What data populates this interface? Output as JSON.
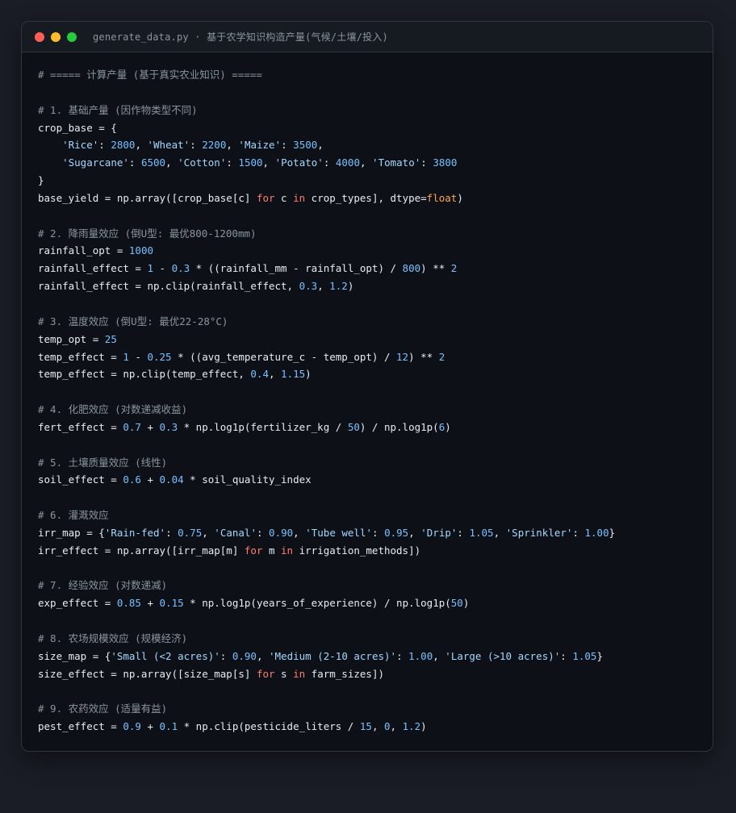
{
  "window": {
    "title": "generate_data.py · 基于农学知识构造产量(气候/土壤/投入)"
  },
  "code_lines": [
    [
      {
        "t": "# ===== 计算产量 (基于真实农业知识) =====",
        "c": "c"
      }
    ],
    [],
    [
      {
        "t": "# 1. 基础产量 (因作物类型不同)",
        "c": "c"
      }
    ],
    [
      {
        "t": "crop_base = {",
        "c": ""
      }
    ],
    [
      {
        "t": "    ",
        "c": ""
      },
      {
        "t": "'Rice'",
        "c": "s"
      },
      {
        "t": ": ",
        "c": ""
      },
      {
        "t": "2800",
        "c": "n"
      },
      {
        "t": ", ",
        "c": ""
      },
      {
        "t": "'Wheat'",
        "c": "s"
      },
      {
        "t": ": ",
        "c": ""
      },
      {
        "t": "2200",
        "c": "n"
      },
      {
        "t": ", ",
        "c": ""
      },
      {
        "t": "'Maize'",
        "c": "s"
      },
      {
        "t": ": ",
        "c": ""
      },
      {
        "t": "3500",
        "c": "n"
      },
      {
        "t": ",",
        "c": ""
      }
    ],
    [
      {
        "t": "    ",
        "c": ""
      },
      {
        "t": "'Sugarcane'",
        "c": "s"
      },
      {
        "t": ": ",
        "c": ""
      },
      {
        "t": "6500",
        "c": "n"
      },
      {
        "t": ", ",
        "c": ""
      },
      {
        "t": "'Cotton'",
        "c": "s"
      },
      {
        "t": ": ",
        "c": ""
      },
      {
        "t": "1500",
        "c": "n"
      },
      {
        "t": ", ",
        "c": ""
      },
      {
        "t": "'Potato'",
        "c": "s"
      },
      {
        "t": ": ",
        "c": ""
      },
      {
        "t": "4000",
        "c": "n"
      },
      {
        "t": ", ",
        "c": ""
      },
      {
        "t": "'Tomato'",
        "c": "s"
      },
      {
        "t": ": ",
        "c": ""
      },
      {
        "t": "3800",
        "c": "n"
      }
    ],
    [
      {
        "t": "}",
        "c": ""
      }
    ],
    [
      {
        "t": "base_yield = np.array([crop_base[c] ",
        "c": ""
      },
      {
        "t": "for",
        "c": "k"
      },
      {
        "t": " c ",
        "c": ""
      },
      {
        "t": "in",
        "c": "k"
      },
      {
        "t": " crop_types], dtype=",
        "c": ""
      },
      {
        "t": "float",
        "c": "b"
      },
      {
        "t": ")",
        "c": ""
      }
    ],
    [],
    [
      {
        "t": "# 2. 降雨量效应 (倒U型: 最优800-1200mm)",
        "c": "c"
      }
    ],
    [
      {
        "t": "rainfall_opt = ",
        "c": ""
      },
      {
        "t": "1000",
        "c": "n"
      }
    ],
    [
      {
        "t": "rainfall_effect = ",
        "c": ""
      },
      {
        "t": "1",
        "c": "n"
      },
      {
        "t": " - ",
        "c": ""
      },
      {
        "t": "0.3",
        "c": "n"
      },
      {
        "t": " * ((rainfall_mm - rainfall_opt) / ",
        "c": ""
      },
      {
        "t": "800",
        "c": "n"
      },
      {
        "t": ") ** ",
        "c": ""
      },
      {
        "t": "2",
        "c": "n"
      }
    ],
    [
      {
        "t": "rainfall_effect = np.clip(rainfall_effect, ",
        "c": ""
      },
      {
        "t": "0.3",
        "c": "n"
      },
      {
        "t": ", ",
        "c": ""
      },
      {
        "t": "1.2",
        "c": "n"
      },
      {
        "t": ")",
        "c": ""
      }
    ],
    [],
    [
      {
        "t": "# 3. 温度效应 (倒U型: 最优22-28°C)",
        "c": "c"
      }
    ],
    [
      {
        "t": "temp_opt = ",
        "c": ""
      },
      {
        "t": "25",
        "c": "n"
      }
    ],
    [
      {
        "t": "temp_effect = ",
        "c": ""
      },
      {
        "t": "1",
        "c": "n"
      },
      {
        "t": " - ",
        "c": ""
      },
      {
        "t": "0.25",
        "c": "n"
      },
      {
        "t": " * ((avg_temperature_c - temp_opt) / ",
        "c": ""
      },
      {
        "t": "12",
        "c": "n"
      },
      {
        "t": ") ** ",
        "c": ""
      },
      {
        "t": "2",
        "c": "n"
      }
    ],
    [
      {
        "t": "temp_effect = np.clip(temp_effect, ",
        "c": ""
      },
      {
        "t": "0.4",
        "c": "n"
      },
      {
        "t": ", ",
        "c": ""
      },
      {
        "t": "1.15",
        "c": "n"
      },
      {
        "t": ")",
        "c": ""
      }
    ],
    [],
    [
      {
        "t": "# 4. 化肥效应 (对数递减收益)",
        "c": "c"
      }
    ],
    [
      {
        "t": "fert_effect = ",
        "c": ""
      },
      {
        "t": "0.7",
        "c": "n"
      },
      {
        "t": " + ",
        "c": ""
      },
      {
        "t": "0.3",
        "c": "n"
      },
      {
        "t": " * np.log1p(fertilizer_kg / ",
        "c": ""
      },
      {
        "t": "50",
        "c": "n"
      },
      {
        "t": ") / np.log1p(",
        "c": ""
      },
      {
        "t": "6",
        "c": "n"
      },
      {
        "t": ")",
        "c": ""
      }
    ],
    [],
    [
      {
        "t": "# 5. 土壤质量效应 (线性)",
        "c": "c"
      }
    ],
    [
      {
        "t": "soil_effect = ",
        "c": ""
      },
      {
        "t": "0.6",
        "c": "n"
      },
      {
        "t": " + ",
        "c": ""
      },
      {
        "t": "0.04",
        "c": "n"
      },
      {
        "t": " * soil_quality_index",
        "c": ""
      }
    ],
    [],
    [
      {
        "t": "# 6. 灌溉效应",
        "c": "c"
      }
    ],
    [
      {
        "t": "irr_map = {",
        "c": ""
      },
      {
        "t": "'Rain-fed'",
        "c": "s"
      },
      {
        "t": ": ",
        "c": ""
      },
      {
        "t": "0.75",
        "c": "n"
      },
      {
        "t": ", ",
        "c": ""
      },
      {
        "t": "'Canal'",
        "c": "s"
      },
      {
        "t": ": ",
        "c": ""
      },
      {
        "t": "0.90",
        "c": "n"
      },
      {
        "t": ", ",
        "c": ""
      },
      {
        "t": "'Tube well'",
        "c": "s"
      },
      {
        "t": ": ",
        "c": ""
      },
      {
        "t": "0.95",
        "c": "n"
      },
      {
        "t": ", ",
        "c": ""
      },
      {
        "t": "'Drip'",
        "c": "s"
      },
      {
        "t": ": ",
        "c": ""
      },
      {
        "t": "1.05",
        "c": "n"
      },
      {
        "t": ", ",
        "c": ""
      },
      {
        "t": "'Sprinkler'",
        "c": "s"
      },
      {
        "t": ": ",
        "c": ""
      },
      {
        "t": "1.00",
        "c": "n"
      },
      {
        "t": "}",
        "c": ""
      }
    ],
    [
      {
        "t": "irr_effect = np.array([irr_map[m] ",
        "c": ""
      },
      {
        "t": "for",
        "c": "k"
      },
      {
        "t": " m ",
        "c": ""
      },
      {
        "t": "in",
        "c": "k"
      },
      {
        "t": " irrigation_methods])",
        "c": ""
      }
    ],
    [],
    [
      {
        "t": "# 7. 经验效应 (对数递减)",
        "c": "c"
      }
    ],
    [
      {
        "t": "exp_effect = ",
        "c": ""
      },
      {
        "t": "0.85",
        "c": "n"
      },
      {
        "t": " + ",
        "c": ""
      },
      {
        "t": "0.15",
        "c": "n"
      },
      {
        "t": " * np.log1p(years_of_experience) / np.log1p(",
        "c": ""
      },
      {
        "t": "50",
        "c": "n"
      },
      {
        "t": ")",
        "c": ""
      }
    ],
    [],
    [
      {
        "t": "# 8. 农场规模效应 (规模经济)",
        "c": "c"
      }
    ],
    [
      {
        "t": "size_map = {",
        "c": ""
      },
      {
        "t": "'Small (<2 acres)'",
        "c": "s"
      },
      {
        "t": ": ",
        "c": ""
      },
      {
        "t": "0.90",
        "c": "n"
      },
      {
        "t": ", ",
        "c": ""
      },
      {
        "t": "'Medium (2-10 acres)'",
        "c": "s"
      },
      {
        "t": ": ",
        "c": ""
      },
      {
        "t": "1.00",
        "c": "n"
      },
      {
        "t": ", ",
        "c": ""
      },
      {
        "t": "'Large (>10 acres)'",
        "c": "s"
      },
      {
        "t": ": ",
        "c": ""
      },
      {
        "t": "1.05",
        "c": "n"
      },
      {
        "t": "}",
        "c": ""
      }
    ],
    [
      {
        "t": "size_effect = np.array([size_map[s] ",
        "c": ""
      },
      {
        "t": "for",
        "c": "k"
      },
      {
        "t": " s ",
        "c": ""
      },
      {
        "t": "in",
        "c": "k"
      },
      {
        "t": " farm_sizes])",
        "c": ""
      }
    ],
    [],
    [
      {
        "t": "# 9. 农药效应 (适量有益)",
        "c": "c"
      }
    ],
    [
      {
        "t": "pest_effect = ",
        "c": ""
      },
      {
        "t": "0.9",
        "c": "n"
      },
      {
        "t": " + ",
        "c": ""
      },
      {
        "t": "0.1",
        "c": "n"
      },
      {
        "t": " * np.clip(pesticide_liters / ",
        "c": ""
      },
      {
        "t": "15",
        "c": "n"
      },
      {
        "t": ", ",
        "c": ""
      },
      {
        "t": "0",
        "c": "n"
      },
      {
        "t": ", ",
        "c": ""
      },
      {
        "t": "1.2",
        "c": "n"
      },
      {
        "t": ")",
        "c": ""
      }
    ]
  ]
}
